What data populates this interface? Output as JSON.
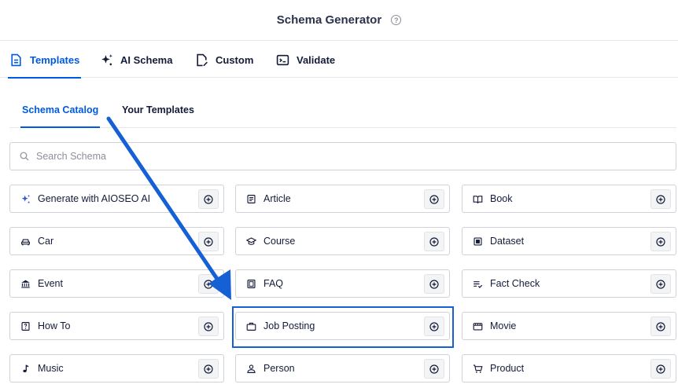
{
  "header": {
    "title": "Schema Generator",
    "help_icon": "question-circle-icon"
  },
  "main_tabs": [
    {
      "label": "Templates",
      "icon": "document-icon",
      "active": true
    },
    {
      "label": "AI Schema",
      "icon": "sparkles-icon",
      "active": false
    },
    {
      "label": "Custom",
      "icon": "edit-document-icon",
      "active": false
    },
    {
      "label": "Validate",
      "icon": "terminal-icon",
      "active": false
    }
  ],
  "sub_tabs": [
    {
      "label": "Schema Catalog",
      "active": true
    },
    {
      "label": "Your Templates",
      "active": false
    }
  ],
  "search": {
    "placeholder": "Search Schema",
    "value": ""
  },
  "schema_items": [
    {
      "label": "Generate with AIOSEO AI",
      "icon": "sparkles-icon"
    },
    {
      "label": "Article",
      "icon": "article-icon"
    },
    {
      "label": "Book",
      "icon": "book-icon"
    },
    {
      "label": "Car",
      "icon": "car-icon"
    },
    {
      "label": "Course",
      "icon": "graduation-cap-icon"
    },
    {
      "label": "Dataset",
      "icon": "dataset-icon"
    },
    {
      "label": "Event",
      "icon": "building-icon"
    },
    {
      "label": "FAQ",
      "icon": "faq-icon"
    },
    {
      "label": "Fact Check",
      "icon": "fact-check-icon"
    },
    {
      "label": "How To",
      "icon": "how-to-icon"
    },
    {
      "label": "Job Posting",
      "icon": "briefcase-icon"
    },
    {
      "label": "Movie",
      "icon": "movie-icon"
    },
    {
      "label": "Music",
      "icon": "music-note-icon"
    },
    {
      "label": "Person",
      "icon": "person-icon"
    },
    {
      "label": "Product",
      "icon": "cart-icon"
    }
  ],
  "colors": {
    "accent": "#005ae0",
    "text": "#141b38",
    "border": "#d0d1d7",
    "annotation": "#1560d4"
  }
}
